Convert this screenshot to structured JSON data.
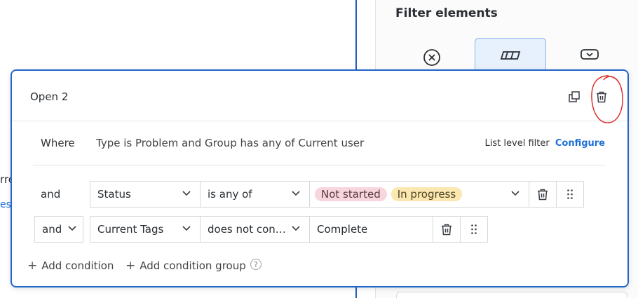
{
  "background": {
    "panel_title": "Filter elements",
    "fragment_1": "rre",
    "fragment_2": "est"
  },
  "dialog": {
    "title": "Open 2",
    "icons": {
      "duplicate": "duplicate-icon",
      "delete": "trash-icon"
    },
    "where": {
      "label": "Where",
      "text": "Type is Problem and Group has any of Current user",
      "list_level_label": "List level filter",
      "configure_label": "Configure"
    },
    "conditions": [
      {
        "conjunction": "and",
        "field": "Status",
        "operator": "is any of",
        "values": [
          {
            "text": "Not started",
            "color": "#f8d6de"
          },
          {
            "text": "In progress",
            "color": "#fbe8b0"
          }
        ]
      },
      {
        "conjunction": "and",
        "field": "Current Tags",
        "operator": "does not con…",
        "value_text": "Complete"
      }
    ],
    "footer": {
      "add_condition": "Add condition",
      "add_condition_group": "Add condition group",
      "help": "?"
    }
  },
  "colors": {
    "accent": "#2166c9",
    "link": "#1f6fd6",
    "annotation": "#e02020"
  }
}
